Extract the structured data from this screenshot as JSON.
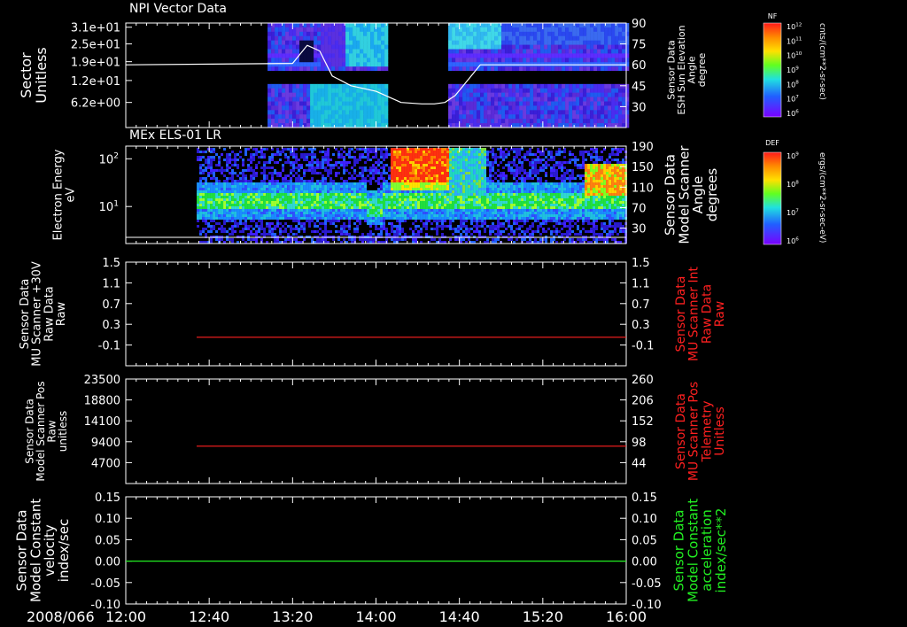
{
  "chart_data": [
    {
      "type": "heatmap",
      "title": "NPI Vector Data",
      "ylabel": "Sector\nUnitless",
      "yticks": [
        "3.1e+01",
        "2.5e+01",
        "1.9e+01",
        "1.2e+01",
        "6.2e+00"
      ],
      "y2label": "Sensor Data\nESH Sun Elevation\nAngle\ndegree",
      "y2ticks": [
        "90",
        "75",
        "60",
        "45",
        "30"
      ],
      "ylim_right": [
        15,
        90
      ],
      "gaps": [
        [
          "13:00",
          "13:08"
        ],
        [
          "14:06",
          "14:34"
        ]
      ],
      "colorbar": {
        "label": "NF",
        "unit": "cnts/(cm**2-sr-sec)",
        "ticks": [
          "10^12",
          "10^11",
          "10^10",
          "10^9",
          "10^8",
          "10^7",
          "10^6"
        ]
      },
      "overlay_line": {
        "color": "#ffffff",
        "x": [
          "12:00",
          "13:20",
          "13:27",
          "13:33",
          "13:39",
          "13:48",
          "14:00",
          "14:12",
          "14:22",
          "14:28",
          "14:33",
          "14:38",
          "14:50",
          "16:00"
        ],
        "y": [
          60,
          61,
          74,
          70,
          52,
          45,
          41,
          33,
          32,
          32,
          33,
          38,
          60,
          60
        ]
      }
    },
    {
      "type": "heatmap",
      "title": "MEx ELS-01 LR",
      "ylabel": "Electron Energy\neV",
      "yticks": [
        "10^2",
        "10^1"
      ],
      "y2label": "Sensor Data\nModel Scanner\nAngle\ndegrees",
      "y2ticks": [
        "190",
        "150",
        "110",
        "70",
        "30"
      ],
      "ylim_right": [
        0,
        190
      ],
      "colorbar": {
        "label": "DEF",
        "unit": "ergs/(cm**2-sr-sec-eV)",
        "ticks": [
          "10^9",
          "10^8",
          "10^7",
          "10^6"
        ]
      },
      "overlay_line": {
        "color": "#ffffff",
        "x": [
          "12:00",
          "16:00"
        ],
        "y": [
          12,
          12
        ]
      }
    },
    {
      "type": "line",
      "ylabel": "Sensor Data\nMU Scanner +30V\nRaw Data\nRaw",
      "yticks": [
        "1.5",
        "1.1",
        "0.7",
        "0.3",
        "-0.1"
      ],
      "ylim": [
        -0.5,
        1.5
      ],
      "y2label": "Sensor Data\nMU Scanner Int\nRaw Data\nRaw",
      "y2ticks": [
        "1.5",
        "1.1",
        "0.7",
        "0.3",
        "-0.1"
      ],
      "series": [
        {
          "color": "#ff2020",
          "x": [
            "12:34",
            "16:00"
          ],
          "y": [
            0.05,
            0.05
          ]
        }
      ]
    },
    {
      "type": "line",
      "ylabel": "Sensor Data\nModel Scanner Pos\nRaw\nunitless",
      "yticks": [
        "23500",
        "18800",
        "14100",
        "9400",
        "4700"
      ],
      "ylim": [
        0,
        23500
      ],
      "y2label": "Sensor Data\nMU Scanner Pos\nTelemetry\nUnitless",
      "y2ticks": [
        "260",
        "206",
        "152",
        "98",
        "44"
      ],
      "series": [
        {
          "color": "#ff2020",
          "x": [
            "12:34",
            "16:00"
          ],
          "y": [
            8400,
            8400
          ]
        }
      ]
    },
    {
      "type": "line",
      "ylabel": "Sensor Data\nModel Constant\nvelocity\nindex/sec",
      "yticks": [
        "0.15",
        "0.10",
        "0.05",
        "0.00",
        "-0.05",
        "-0.10"
      ],
      "ylim": [
        -0.1,
        0.15
      ],
      "y2label": "Sensor Data\nModel Constant\nacceleration\nindex/sec**2",
      "y2ticks": [
        "0.15",
        "0.10",
        "0.05",
        "0.00",
        "-0.05",
        "-0.10"
      ],
      "series": [
        {
          "color": "#22ee22",
          "x": [
            "12:00",
            "16:00"
          ],
          "y": [
            0.0,
            0.0
          ]
        }
      ]
    }
  ],
  "xaxis": {
    "date": "2008/066",
    "ticks": [
      "12:00",
      "12:40",
      "13:20",
      "14:00",
      "14:40",
      "15:20",
      "16:00"
    ],
    "range": [
      "12:00",
      "16:00"
    ]
  }
}
